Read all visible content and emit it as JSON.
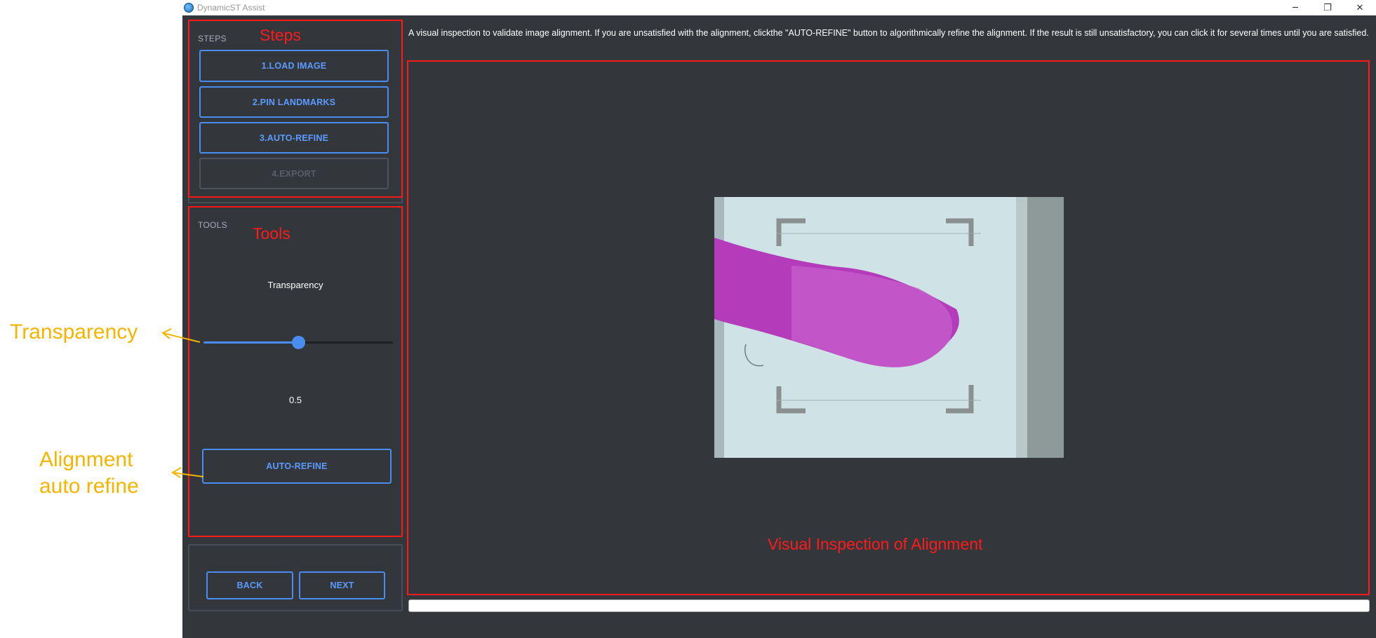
{
  "window": {
    "title": "DynamicST Assist",
    "controls": {
      "minimize": "─",
      "restore": "❐",
      "close": "✕"
    }
  },
  "steps_panel": {
    "caption": "STEPS",
    "overlay_label": "Steps",
    "buttons": [
      {
        "label": "1.LOAD IMAGE",
        "enabled": true
      },
      {
        "label": "2.PIN LANDMARKS",
        "enabled": true
      },
      {
        "label": "3.AUTO-REFINE",
        "enabled": true
      },
      {
        "label": "4.EXPORT",
        "enabled": false
      }
    ]
  },
  "tools_panel": {
    "caption": "TOOLS",
    "overlay_label": "Tools",
    "slider_label": "Transparency",
    "slider_value": 0.5,
    "slider_value_text": "0.5",
    "auto_refine_label": "AUTO-REFINE"
  },
  "nav": {
    "back_label": "BACK",
    "next_label": "NEXT"
  },
  "instructions": "A visual inspection to validate image alignment. If you are unsatisfied with the alignment, clickthe \"AUTO-REFINE\" button to algorithmically refine the alignment. If the result is still unsatisfactory, you can click it for several times until you are satisfied.",
  "viewer": {
    "caption": "Visual Inspection of Alignment"
  },
  "annotations": {
    "transparency": "Transparency",
    "auto_refine_line1": "Alignment",
    "auto_refine_line2": "auto refine"
  },
  "colors": {
    "accent": "#4a8df0",
    "annotation_red": "#ff1a1a",
    "callout_yellow": "#f5b400",
    "window_bg": "#33373c",
    "tissue": "#b23ab8"
  }
}
